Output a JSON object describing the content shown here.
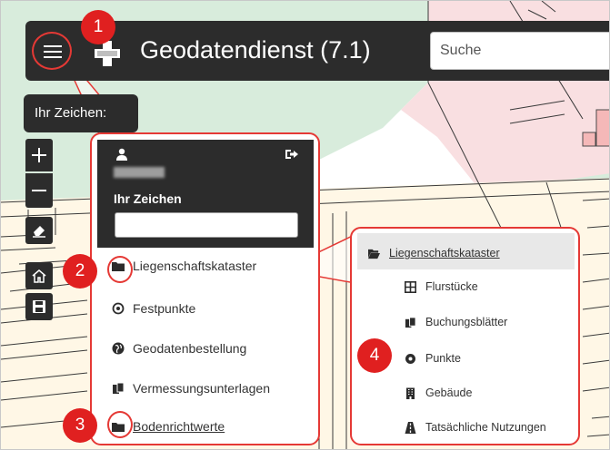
{
  "header": {
    "title": "Geodatendienst (7.1)",
    "search_placeholder": "Suche"
  },
  "tooltip": {
    "text": "Ihr Zeichen:"
  },
  "map_tools": [
    {
      "name": "zoom-in",
      "icon": "plus-icon"
    },
    {
      "name": "zoom-out",
      "icon": "minus-icon"
    },
    {
      "name": "eraser",
      "icon": "eraser-icon"
    },
    {
      "name": "home",
      "icon": "home-icon"
    },
    {
      "name": "save",
      "icon": "floppy-icon"
    }
  ],
  "menu": {
    "user_name": "(blurred)",
    "zeichen_label": "Ihr Zeichen",
    "zeichen_value": "",
    "items": [
      {
        "label": "Liegenschaftskataster",
        "icon": "folder-icon"
      },
      {
        "label": "Festpunkte",
        "icon": "target-icon"
      },
      {
        "label": "Geodatenbestellung",
        "icon": "globe-icon"
      },
      {
        "label": "Vermessungsunterlagen",
        "icon": "documents-icon"
      },
      {
        "label": "Bodenrichtwerte",
        "icon": "folder-icon"
      }
    ]
  },
  "submenu": {
    "header": {
      "label": "Liegenschaftskataster",
      "icon": "folder-open-icon"
    },
    "items": [
      {
        "label": "Flurstücke",
        "icon": "grid-icon"
      },
      {
        "label": "Buchungsblätter",
        "icon": "documents-icon"
      },
      {
        "label": "Punkte",
        "icon": "circle-dot-icon"
      },
      {
        "label": "Gebäude",
        "icon": "building-icon"
      },
      {
        "label": "Tatsächliche Nutzungen",
        "icon": "road-icon"
      }
    ]
  },
  "annotations": [
    "1",
    "2",
    "3",
    "4"
  ],
  "colors": {
    "header_bg": "#2c2c2c",
    "accent_red": "#e53935",
    "map_green": "#d8ecdc",
    "map_pink": "#f9dfe1",
    "map_yellow": "#fff7e6",
    "parcel_line": "#4a4a4a"
  }
}
